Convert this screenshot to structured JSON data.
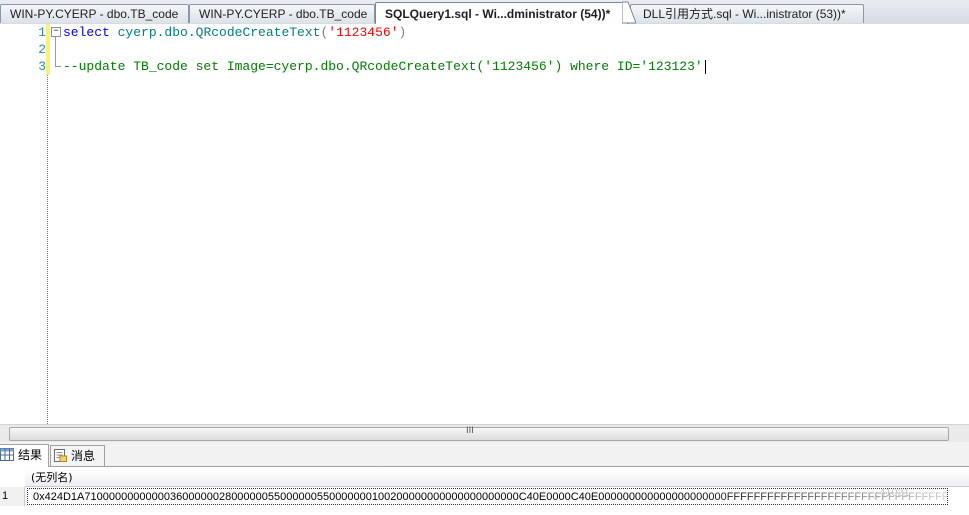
{
  "tabs": [
    {
      "label": "WIN-PY.CYERP - dbo.TB_code",
      "active": false
    },
    {
      "label": "WIN-PY.CYERP - dbo.TB_code",
      "active": false
    },
    {
      "label": "SQLQuery1.sql - Wi...dministrator (54))*",
      "active": true
    },
    {
      "label": "DLL引用方式.sql - Wi...inistrator (53))*",
      "active": false
    }
  ],
  "editor": {
    "line_numbers": [
      "1",
      "2",
      "3"
    ],
    "line1": {
      "keyword": "select",
      "object": "cyerp.dbo.QRcodeCreateText",
      "open_paren": "(",
      "string": "'1123456'",
      "close_paren": ")"
    },
    "line3": {
      "comment": "--update TB_code set Image=cyerp.dbo.QRcodeCreateText('1123456') where ID='123123'"
    },
    "collapse_glyph": "−"
  },
  "scrollbar": {
    "grip": "III"
  },
  "results": {
    "tabs": [
      {
        "label": "结果",
        "icon": "grid-icon",
        "active": true
      },
      {
        "label": "消息",
        "icon": "message-icon",
        "active": false
      }
    ],
    "column_header": "(无列名)",
    "rows": [
      {
        "row_number": "1",
        "value": "0x424D1A71000000000000360000002800000055000000550000000100200000000000000000000C40E0000C40E000000000000000000000FFFFFFFFFFFFFFFFFFFFFFFFFFFFFFFFFFFFFFFFFFFFFFFFFFFFFFFFFFFFFFFFFFFFFFFF"
      }
    ],
    "watermark": "_41021"
  },
  "colors": {
    "keyword": "#0000ff",
    "object": "#008080",
    "string": "#ff0000",
    "comment": "#008000",
    "line_number": "#2b91af",
    "change_margin": "#fdf07a"
  }
}
